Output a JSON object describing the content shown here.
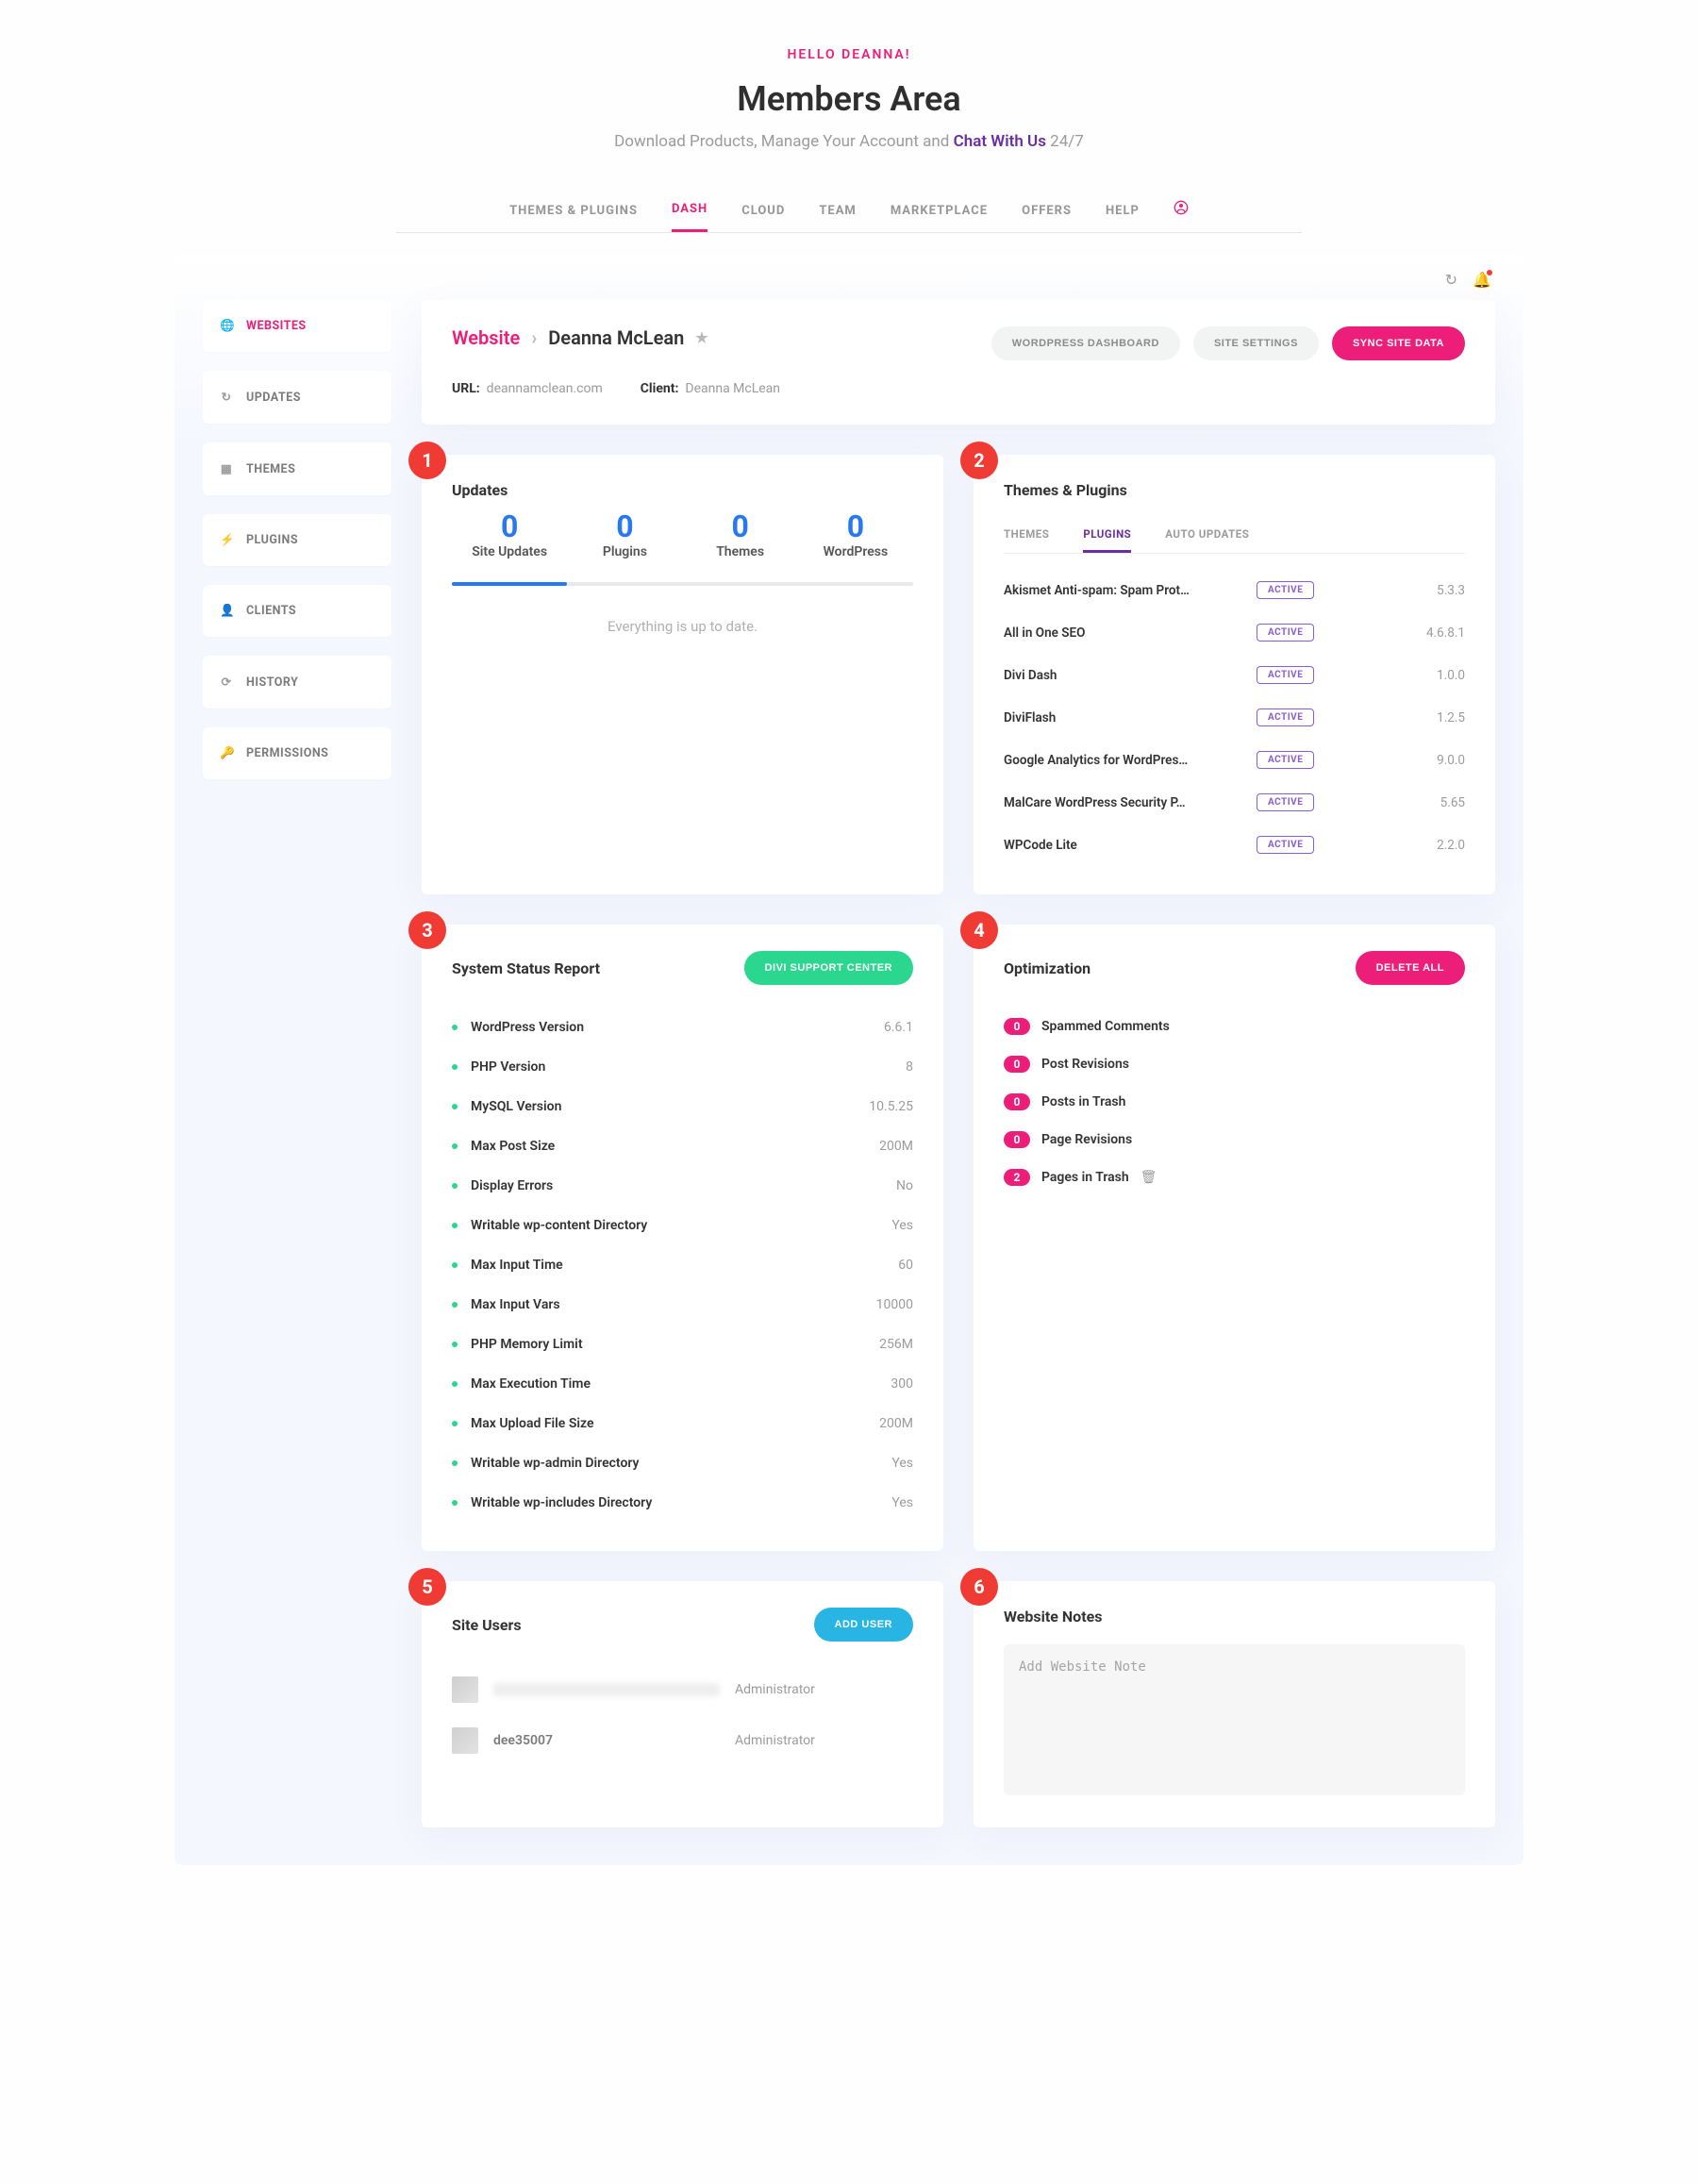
{
  "header": {
    "hello": "HELLO DEANNA!",
    "title": "Members Area",
    "subtitle_pre": "Download Products, Manage Your Account and ",
    "subtitle_link": "Chat With Us",
    "subtitle_post": " 24/7"
  },
  "topnav": {
    "items": [
      "THEMES & PLUGINS",
      "DASH",
      "CLOUD",
      "TEAM",
      "MARKETPLACE",
      "OFFERS",
      "HELP"
    ],
    "active_index": 1
  },
  "sidebar": {
    "items": [
      {
        "icon": "globe",
        "label": "WEBSITES",
        "active": true
      },
      {
        "icon": "refresh",
        "label": "UPDATES"
      },
      {
        "icon": "grid",
        "label": "THEMES"
      },
      {
        "icon": "plug",
        "label": "PLUGINS"
      },
      {
        "icon": "user",
        "label": "CLIENTS"
      },
      {
        "icon": "history",
        "label": "HISTORY"
      },
      {
        "icon": "key",
        "label": "PERMISSIONS"
      }
    ]
  },
  "site": {
    "bc_website": "Website",
    "bc_name": "Deanna McLean",
    "actions": {
      "wp_dashboard": "WORDPRESS DASHBOARD",
      "site_settings": "SITE SETTINGS",
      "sync": "SYNC SITE DATA"
    },
    "url_label": "URL:",
    "url": "deannamclean.com",
    "client_label": "Client:",
    "client": "Deanna McLean"
  },
  "callouts": {
    "c1": "1",
    "c2": "2",
    "c3": "3",
    "c4": "4",
    "c5": "5",
    "c6": "6"
  },
  "updates": {
    "title": "Updates",
    "cols": [
      {
        "num": "0",
        "label": "Site Updates"
      },
      {
        "num": "0",
        "label": "Plugins"
      },
      {
        "num": "0",
        "label": "Themes"
      },
      {
        "num": "0",
        "label": "WordPress"
      }
    ],
    "empty": "Everything is up to date."
  },
  "themes_plugins": {
    "title": "Themes & Plugins",
    "tabs": [
      "THEMES",
      "PLUGINS",
      "AUTO UPDATES"
    ],
    "active_tab": 1,
    "rows": [
      {
        "name": "Akismet Anti-spam: Spam Prot…",
        "badge": "ACTIVE",
        "version": "5.3.3"
      },
      {
        "name": "All in One SEO",
        "badge": "ACTIVE",
        "version": "4.6.8.1"
      },
      {
        "name": "Divi Dash",
        "badge": "ACTIVE",
        "version": "1.0.0"
      },
      {
        "name": "DiviFlash",
        "badge": "ACTIVE",
        "version": "1.2.5"
      },
      {
        "name": "Google Analytics for WordPres…",
        "badge": "ACTIVE",
        "version": "9.0.0"
      },
      {
        "name": "MalCare WordPress Security P…",
        "badge": "ACTIVE",
        "version": "5.65"
      },
      {
        "name": "WPCode Lite",
        "badge": "ACTIVE",
        "version": "2.2.0"
      }
    ]
  },
  "status": {
    "title": "System Status Report",
    "button": "DIVI SUPPORT CENTER",
    "rows": [
      {
        "label": "WordPress Version",
        "value": "6.6.1"
      },
      {
        "label": "PHP Version",
        "value": "8"
      },
      {
        "label": "MySQL Version",
        "value": "10.5.25"
      },
      {
        "label": "Max Post Size",
        "value": "200M"
      },
      {
        "label": "Display Errors",
        "value": "No"
      },
      {
        "label": "Writable wp-content Directory",
        "value": "Yes"
      },
      {
        "label": "Max Input Time",
        "value": "60"
      },
      {
        "label": "Max Input Vars",
        "value": "10000"
      },
      {
        "label": "PHP Memory Limit",
        "value": "256M"
      },
      {
        "label": "Max Execution Time",
        "value": "300"
      },
      {
        "label": "Max Upload File Size",
        "value": "200M"
      },
      {
        "label": "Writable wp-admin Directory",
        "value": "Yes"
      },
      {
        "label": "Writable wp-includes Directory",
        "value": "Yes"
      }
    ]
  },
  "optimization": {
    "title": "Optimization",
    "button": "DELETE ALL",
    "rows": [
      {
        "count": "0",
        "label": "Spammed Comments"
      },
      {
        "count": "0",
        "label": "Post Revisions"
      },
      {
        "count": "0",
        "label": "Posts in Trash"
      },
      {
        "count": "0",
        "label": "Page Revisions"
      },
      {
        "count": "2",
        "label": "Pages in Trash",
        "trash": true
      }
    ]
  },
  "site_users": {
    "title": "Site Users",
    "button": "ADD USER",
    "rows": [
      {
        "name": "",
        "redacted": true,
        "role": "Administrator"
      },
      {
        "name": "dee35007",
        "role": "Administrator"
      }
    ]
  },
  "notes": {
    "title": "Website Notes",
    "placeholder": "Add Website Note"
  }
}
